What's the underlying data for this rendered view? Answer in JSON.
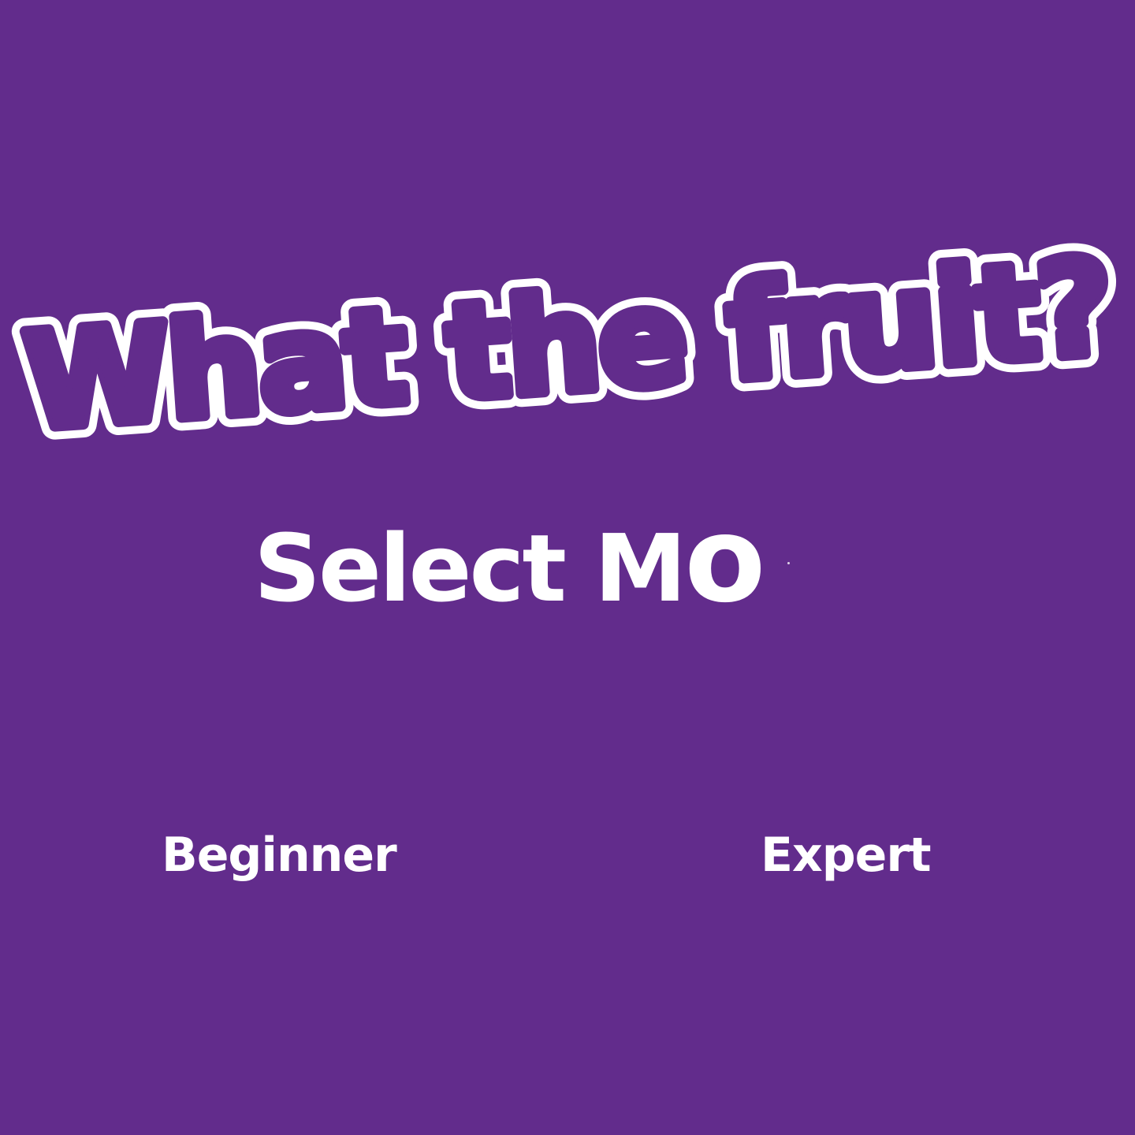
{
  "game": {
    "title": "What the fruit?",
    "heading_main": "Select M",
    "heading_tail": "o",
    "modes": [
      {
        "label": "Beginner"
      },
      {
        "label": "Expert"
      }
    ]
  },
  "colors": {
    "background": "#622C8C",
    "text": "#FFFFFF",
    "logo_outline": "#FFFFFF",
    "logo_fill": "#622C8C"
  }
}
